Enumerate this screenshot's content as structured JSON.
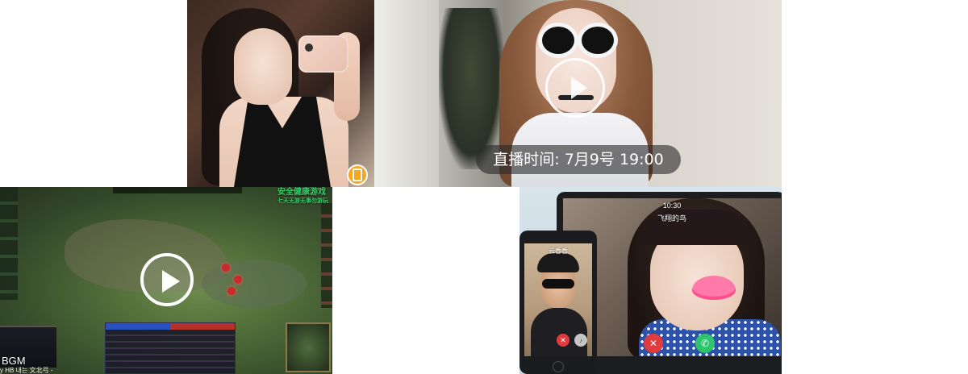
{
  "tiles": {
    "selfie": {},
    "live": {
      "broadcast_time": "直播时间: 7月9号 19:00"
    },
    "game": {
      "health_notice_line1": "安全健康游戏",
      "health_notice_line2": "七天无游无事勿游玩",
      "bgm_label": "BGM",
      "player_line": "y HB 내는 文北弓 -"
    },
    "call": {
      "call_time": "10:30",
      "caller_name": "飞翔的鸟",
      "phone_contact": "云香香"
    }
  },
  "icons": {
    "play_icon": "play-icon",
    "app_badge": "app-badge-icon",
    "hangup": "hangup-icon",
    "answer": "answer-icon",
    "speaker": "speaker-icon"
  },
  "colors": {
    "hangup": "#e23b3b",
    "answer": "#2ec46b",
    "health_notice": "#38d06a",
    "badge": "#f5a623"
  }
}
